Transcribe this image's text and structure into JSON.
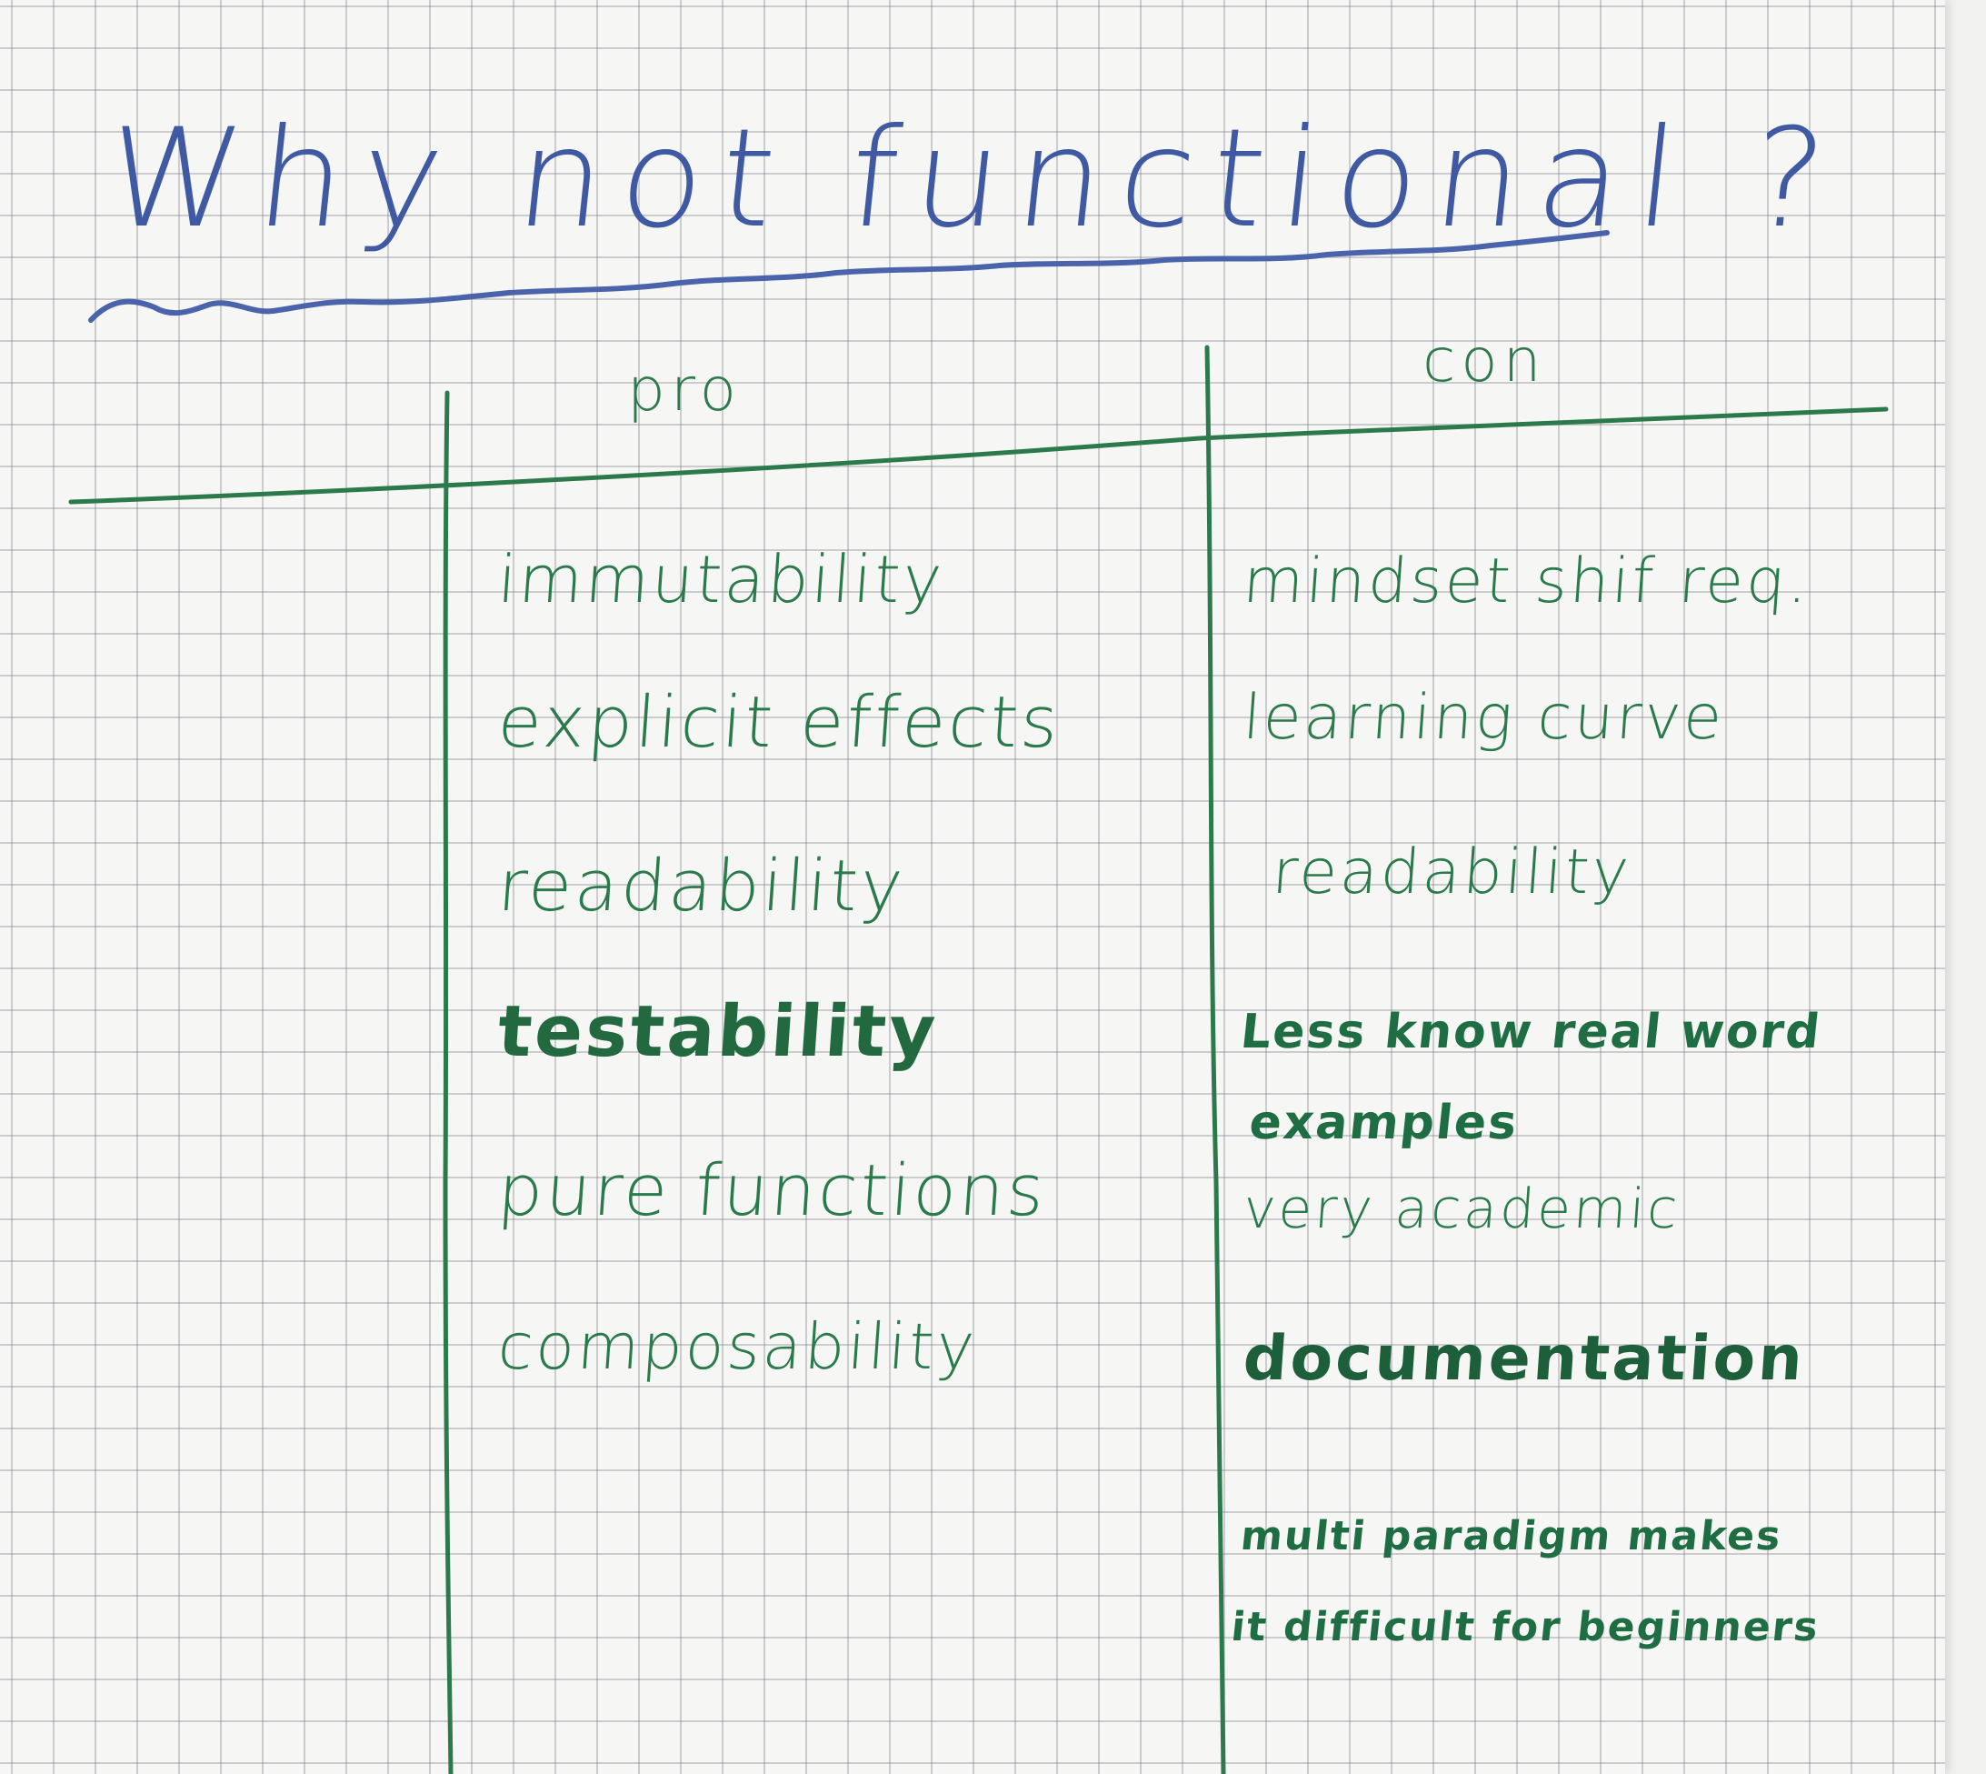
{
  "title": "Why not functional ?",
  "columns": {
    "pro_header": "pro",
    "con_header": "con"
  },
  "pro_items": [
    "immutability",
    "explicit effects",
    "readability",
    "testability",
    "pure functions",
    "composability"
  ],
  "con_items": [
    "mindset shif req.",
    "learning curve",
    "readability",
    "Less know real word\n examples",
    "very academic",
    "documentation",
    "multi paradigm makes\nit difficult for beginners"
  ],
  "colors": {
    "title_ink": "#3f5aa3",
    "list_ink": "#2a7a4b",
    "grid_line": "#8a8a96",
    "paper": "#f6f6f4"
  }
}
